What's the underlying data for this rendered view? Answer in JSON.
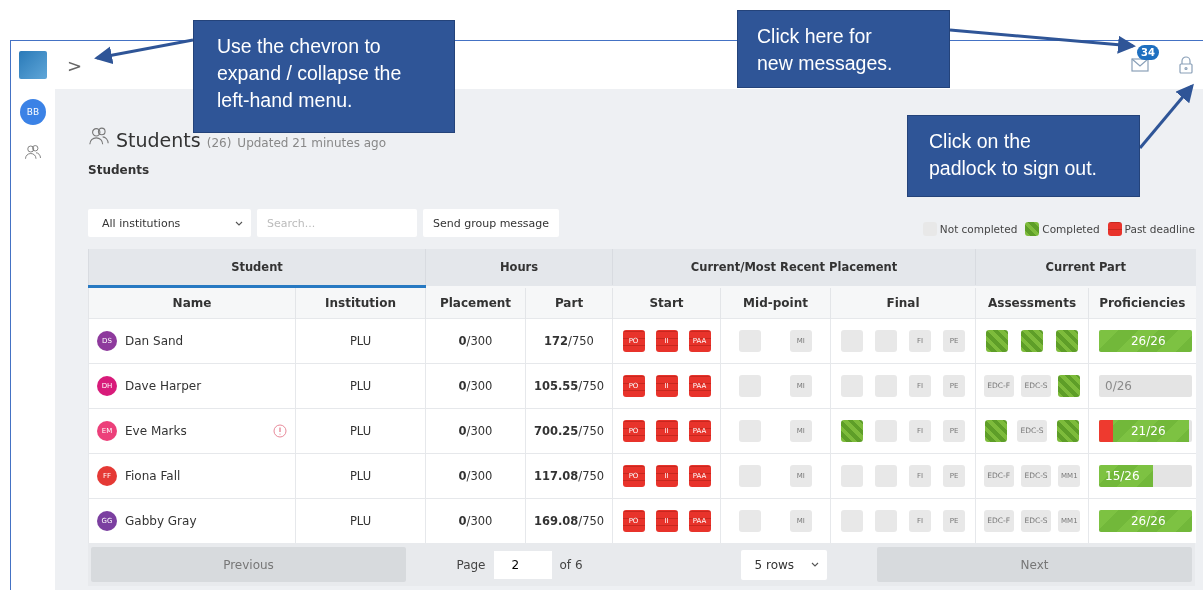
{
  "topbar": {
    "chevron": ">",
    "messages_badge": "34"
  },
  "sidebar": {
    "avatar": "BB"
  },
  "page": {
    "title": "Students",
    "count": "(26)",
    "updated": "Updated 21 minutes ago",
    "subtitle": "Students"
  },
  "toolbar": {
    "institution": "All institutions",
    "search_placeholder": "Search...",
    "button": "Send group message"
  },
  "legend": [
    {
      "label": "Not completed",
      "kind": "pending"
    },
    {
      "label": "Completed",
      "kind": "completed"
    },
    {
      "label": "Past deadline",
      "kind": "overdue"
    }
  ],
  "table": {
    "groups": [
      {
        "label": "Student",
        "selected": true
      },
      {
        "label": "Hours",
        "selected": false
      },
      {
        "label": "Current/Most Recent Placement",
        "selected": false
      },
      {
        "label": "Current Part",
        "selected": false
      }
    ],
    "columns": [
      "Name",
      "Institution",
      "Placement",
      "Part",
      "Start",
      "Mid-point",
      "Final",
      "Assessments",
      "Proficiencies"
    ],
    "rows": [
      {
        "initials": "DS",
        "name": "Dan Sand",
        "color": "#8e3a9d",
        "warning": false,
        "institution": "PLU",
        "placement": "**0**/300",
        "part": "**172**/750",
        "start": [
          {
            "label": "PO",
            "kind": "overdue"
          },
          {
            "label": "II",
            "kind": "overdue"
          },
          {
            "label": "PAA",
            "kind": "overdue"
          }
        ],
        "mid": [
          {
            "kind": "pending"
          },
          {
            "label": "MI",
            "kind": "pending"
          }
        ],
        "final": [
          {
            "kind": "pending"
          },
          {
            "kind": "pending"
          },
          {
            "label": "FI",
            "kind": "pending"
          },
          {
            "label": "PE",
            "kind": "pending"
          }
        ],
        "assessments": [
          {
            "kind": "completed"
          },
          {
            "kind": "completed"
          },
          {
            "kind": "completed"
          }
        ],
        "proficiency": {
          "text": "26/26",
          "level": 1,
          "overdue": false
        }
      },
      {
        "initials": "DH",
        "name": "Dave Harper",
        "color": "#d81b7a",
        "warning": false,
        "institution": "PLU",
        "placement": "**0**/300",
        "part": "**105.55**/750",
        "start": [
          {
            "label": "PO",
            "kind": "overdue"
          },
          {
            "label": "II",
            "kind": "overdue"
          },
          {
            "label": "PAA",
            "kind": "overdue"
          }
        ],
        "mid": [
          {
            "kind": "pending"
          },
          {
            "label": "MI",
            "kind": "pending"
          }
        ],
        "final": [
          {
            "kind": "pending"
          },
          {
            "kind": "pending"
          },
          {
            "label": "FI",
            "kind": "pending"
          },
          {
            "label": "PE",
            "kind": "pending"
          }
        ],
        "assessments": [
          {
            "label": "EDC-F",
            "kind": "pending"
          },
          {
            "label": "EDC-S",
            "kind": "pending"
          },
          {
            "kind": "completed"
          }
        ],
        "proficiency": {
          "text": "0/26",
          "level": 0,
          "overdue": false
        }
      },
      {
        "initials": "EM",
        "name": "Eve Marks",
        "color": "#ec407a",
        "warning": true,
        "institution": "PLU",
        "placement": "**0**/300",
        "part": "**700.25**/750",
        "start": [
          {
            "label": "PO",
            "kind": "overdue"
          },
          {
            "label": "II",
            "kind": "overdue"
          },
          {
            "label": "PAA",
            "kind": "overdue"
          }
        ],
        "mid": [
          {
            "kind": "pending"
          },
          {
            "label": "MI",
            "kind": "pending"
          }
        ],
        "final": [
          {
            "kind": "completed"
          },
          {
            "kind": "pending"
          },
          {
            "label": "FI",
            "kind": "pending"
          },
          {
            "label": "PE",
            "kind": "pending"
          }
        ],
        "assessments": [
          {
            "kind": "completed"
          },
          {
            "label": "EDC-S",
            "kind": "pending"
          },
          {
            "kind": "completed"
          }
        ],
        "proficiency": {
          "text": "21/26",
          "level": 0.97,
          "overdue": true
        }
      },
      {
        "initials": "FF",
        "name": "Fiona Fall",
        "color": "#e53935",
        "warning": false,
        "institution": "PLU",
        "placement": "**0**/300",
        "part": "**117.08**/750",
        "start": [
          {
            "label": "PO",
            "kind": "overdue"
          },
          {
            "label": "II",
            "kind": "overdue"
          },
          {
            "label": "PAA",
            "kind": "overdue"
          }
        ],
        "mid": [
          {
            "kind": "pending"
          },
          {
            "label": "MI",
            "kind": "pending"
          }
        ],
        "final": [
          {
            "kind": "pending"
          },
          {
            "kind": "pending"
          },
          {
            "label": "FI",
            "kind": "pending"
          },
          {
            "label": "PE",
            "kind": "pending"
          }
        ],
        "assessments": [
          {
            "label": "EDC-F",
            "kind": "pending"
          },
          {
            "label": "EDC-S",
            "kind": "pending"
          },
          {
            "label": "MM1",
            "kind": "pending"
          }
        ],
        "proficiency": {
          "text": "15/26",
          "level": 0.58,
          "overdue": false
        }
      },
      {
        "initials": "GG",
        "name": "Gabby Gray",
        "color": "#7b3fa0",
        "warning": false,
        "institution": "PLU",
        "placement": "**0**/300",
        "part": "**169.08**/750",
        "start": [
          {
            "label": "PO",
            "kind": "overdue"
          },
          {
            "label": "II",
            "kind": "overdue"
          },
          {
            "label": "PAA",
            "kind": "overdue"
          }
        ],
        "mid": [
          {
            "kind": "pending"
          },
          {
            "label": "MI",
            "kind": "pending"
          }
        ],
        "final": [
          {
            "kind": "pending"
          },
          {
            "kind": "pending"
          },
          {
            "label": "FI",
            "kind": "pending"
          },
          {
            "label": "PE",
            "kind": "pending"
          }
        ],
        "assessments": [
          {
            "label": "EDC-F",
            "kind": "pending"
          },
          {
            "label": "EDC-S",
            "kind": "pending"
          },
          {
            "label": "MM1",
            "kind": "pending"
          }
        ],
        "proficiency": {
          "text": "26/26",
          "level": 1,
          "overdue": false
        }
      }
    ]
  },
  "pagination": {
    "previous": "Previous",
    "page_label": "Page",
    "page": "2",
    "of": "of 6",
    "rows": "5 rows",
    "next": "Next"
  },
  "callouts": [
    {
      "text": "Use the chevron to expand / collapse the left-hand menu.",
      "kind": "chevron"
    },
    {
      "text": "Click here for new messages.",
      "kind": "messages"
    },
    {
      "text": "Click on the padlock to sign out.",
      "kind": "padlock"
    }
  ]
}
